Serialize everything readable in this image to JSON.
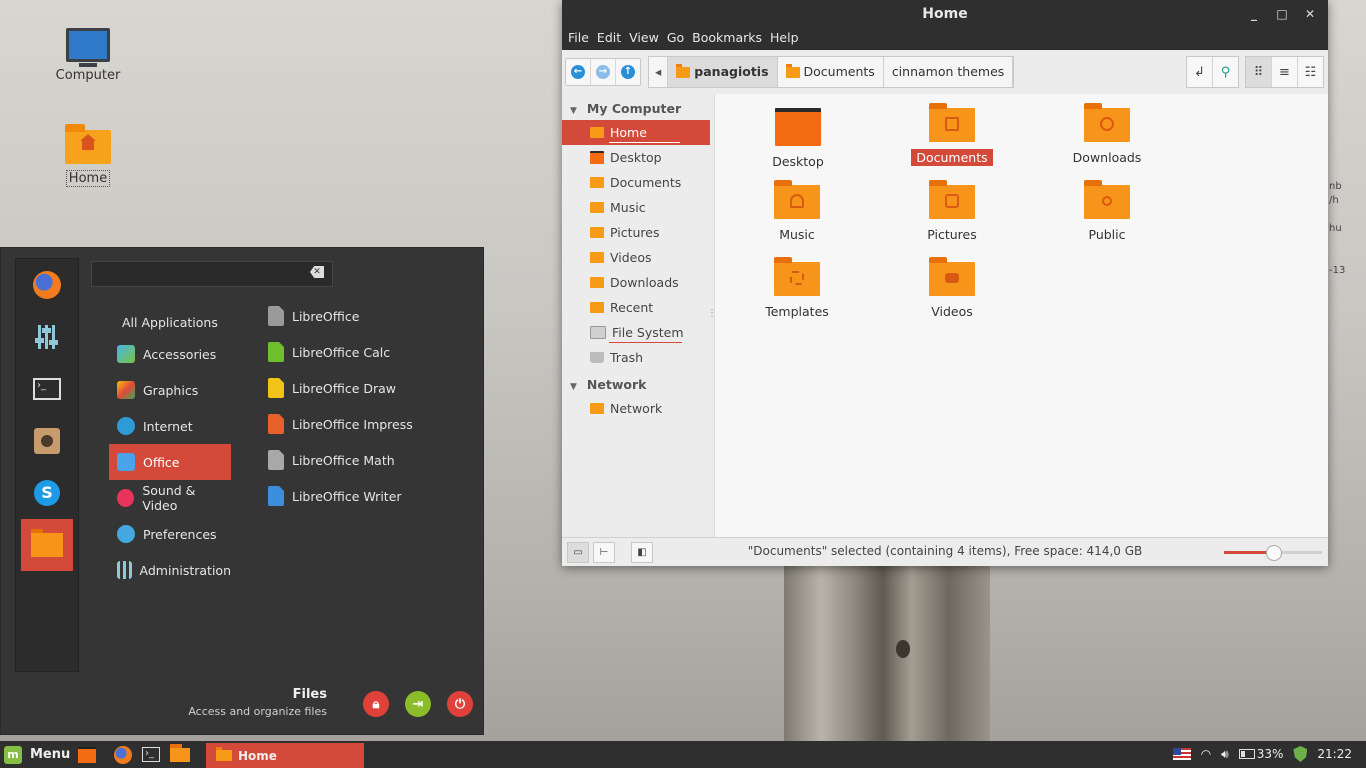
{
  "desktop": {
    "icons": [
      {
        "label": "Computer"
      },
      {
        "label": "Home"
      }
    ]
  },
  "file_manager": {
    "title": "Home",
    "window_buttons": {
      "minimize": "_",
      "maximize": "□",
      "close": "✕"
    },
    "menu": [
      "File",
      "Edit",
      "View",
      "Go",
      "Bookmarks",
      "Help"
    ],
    "breadcrumbs": [
      "panagiotis",
      "Documents",
      "cinnamon themes"
    ],
    "sidebar": {
      "sections": [
        {
          "header": "My Computer",
          "items": [
            "Home",
            "Desktop",
            "Documents",
            "Music",
            "Pictures",
            "Videos",
            "Downloads",
            "Recent",
            "File System",
            "Trash"
          ]
        },
        {
          "header": "Network",
          "items": [
            "Network"
          ]
        }
      ],
      "selected": "Home"
    },
    "items": [
      {
        "name": "Desktop"
      },
      {
        "name": "Documents",
        "selected": true
      },
      {
        "name": "Downloads"
      },
      {
        "name": "Music"
      },
      {
        "name": "Pictures"
      },
      {
        "name": "Public"
      },
      {
        "name": "Templates"
      },
      {
        "name": "Videos"
      }
    ],
    "status": "\"Documents\" selected (containing 4 items), Free space: 414,0 GB",
    "zoom_level": 0.5
  },
  "menu": {
    "search_value": "",
    "categories": [
      "All Applications",
      "Accessories",
      "Graphics",
      "Internet",
      "Office",
      "Sound & Video",
      "Preferences",
      "Administration"
    ],
    "selected_category": "Office",
    "apps": [
      "LibreOffice",
      "LibreOffice Calc",
      "LibreOffice Draw",
      "LibreOffice Impress",
      "LibreOffice Math",
      "LibreOffice Writer"
    ],
    "footer": {
      "title": "Files",
      "subtitle": "Access and organize files"
    }
  },
  "taskbar": {
    "menu_label": "Menu",
    "task_label": "Home",
    "battery": "33%",
    "clock": "21:22"
  },
  "colors": {
    "accent": "#d44a3a",
    "folder": "#f7951a",
    "panel": "#2f2f2f"
  }
}
